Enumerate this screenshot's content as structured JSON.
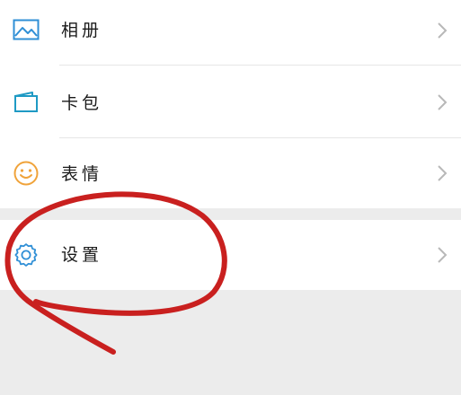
{
  "menu": {
    "items": [
      {
        "label": "相册",
        "icon": "album-icon"
      },
      {
        "label": "卡包",
        "icon": "card-wallet-icon"
      },
      {
        "label": "表情",
        "icon": "emoji-icon"
      },
      {
        "label": "设置",
        "icon": "settings-gear-icon"
      }
    ]
  },
  "colors": {
    "accent_blue": "#2f8fd6",
    "accent_teal": "#1f9ac4",
    "emoji_orange": "#f0a33a",
    "annotation_red": "#c9201f",
    "chevron_gray": "#b8b8b8",
    "background": "#ececec"
  }
}
